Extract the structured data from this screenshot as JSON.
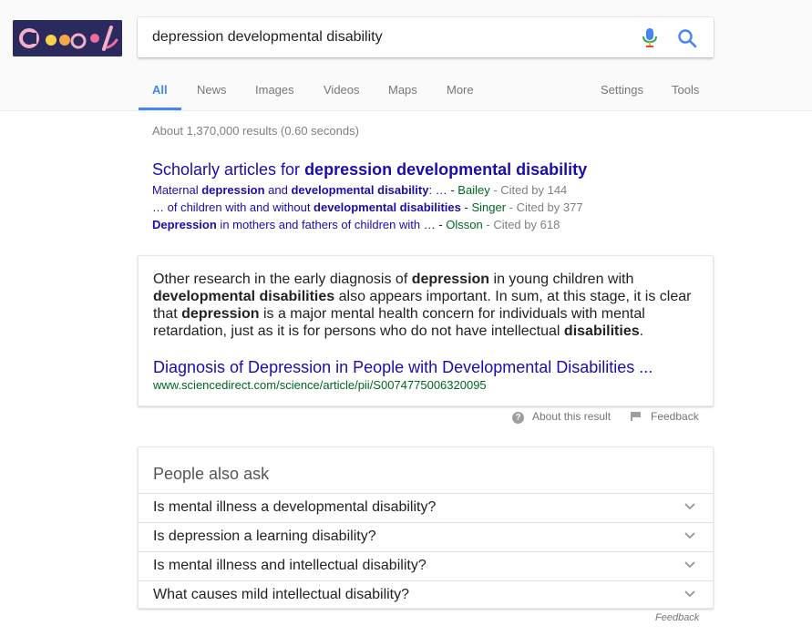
{
  "search": {
    "query": "depression developmental disability"
  },
  "tabs": [
    "All",
    "News",
    "Images",
    "Videos",
    "Maps",
    "More"
  ],
  "tools": {
    "settings_label": "Settings",
    "tools_label": "Tools"
  },
  "result_stats": "About 1,370,000 results (0.60 seconds)",
  "scholar": {
    "title_prefix": "Scholarly articles for ",
    "title_bold": "depression developmental disability",
    "items": [
      {
        "parts": [
          {
            "t": "Maternal ",
            "b": false
          },
          {
            "t": "depression",
            "b": true
          },
          {
            "t": " and ",
            "b": false
          },
          {
            "t": "developmental disability",
            "b": true
          },
          {
            "t": ": …",
            "b": false
          }
        ],
        "author": "Bailey",
        "cited": "Cited by 144"
      },
      {
        "parts": [
          {
            "t": "… of children with and without ",
            "b": false
          },
          {
            "t": "developmental disabilities",
            "b": true
          }
        ],
        "author": "Singer",
        "cited": "Cited by 377"
      },
      {
        "parts": [
          {
            "t": "Depression",
            "b": true
          },
          {
            "t": " in mothers and fathers of children with …",
            "b": false
          }
        ],
        "author": "Olsson",
        "cited": "Cited by 618"
      }
    ]
  },
  "featured_snippet": {
    "text_parts": [
      {
        "t": "Other research in the early diagnosis of ",
        "b": false
      },
      {
        "t": "depression",
        "b": true
      },
      {
        "t": " in young children with ",
        "b": false
      },
      {
        "t": "developmental disabilities",
        "b": true
      },
      {
        "t": " also appears important. In sum, at this stage, it is clear that ",
        "b": false
      },
      {
        "t": "depression",
        "b": true
      },
      {
        "t": " is a major mental health concern for individuals with mental retardation, just as it is for persons who do not have intellectual ",
        "b": false
      },
      {
        "t": "disabilities",
        "b": true
      },
      {
        "t": ".",
        "b": false
      }
    ],
    "link_title": "Diagnosis of Depression in People with Developmental Disabilities ...",
    "url": "www.sciencedirect.com/science/article/pii/S0074775006320095"
  },
  "snippet_footer": {
    "about_label": "About this result",
    "feedback_label": "Feedback"
  },
  "people_also_ask": {
    "title": "People also ask",
    "questions": [
      "Is mental illness a developmental disability?",
      "Is depression a learning disability?",
      "Is mental illness and intellectual disability?",
      "What causes mild intellectual disability?"
    ],
    "feedback_label": "Feedback"
  },
  "colors": {
    "link": "#1a0dab",
    "url_green": "#006621",
    "accent_blue": "#4285f4",
    "doodle_bg": "#2b2a5e"
  },
  "icons": [
    "doodle-logo",
    "mic-icon",
    "search-icon",
    "about-icon",
    "flag-icon",
    "chevron-down-icon"
  ]
}
